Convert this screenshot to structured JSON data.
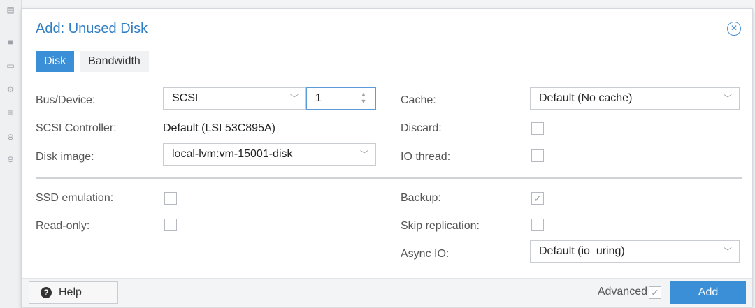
{
  "dialog": {
    "title": "Add: Unused Disk",
    "close_icon": "close-circle-icon"
  },
  "tabs": [
    {
      "label": "Disk",
      "active": true
    },
    {
      "label": "Bandwidth",
      "active": false
    }
  ],
  "left": {
    "bus_device_label": "Bus/Device:",
    "bus_value": "SCSI",
    "device_number": "1",
    "scsi_controller_label": "SCSI Controller:",
    "scsi_controller_value": "Default (LSI 53C895A)",
    "disk_image_label": "Disk image:",
    "disk_image_value": "local-lvm:vm-15001-disk"
  },
  "right": {
    "cache_label": "Cache:",
    "cache_value": "Default (No cache)",
    "discard_label": "Discard:",
    "discard_checked": false,
    "io_thread_label": "IO thread:",
    "io_thread_checked": false
  },
  "advanced_left": {
    "ssd_emulation_label": "SSD emulation:",
    "ssd_emulation_checked": false,
    "read_only_label": "Read-only:",
    "read_only_checked": false
  },
  "advanced_right": {
    "backup_label": "Backup:",
    "backup_checked": true,
    "skip_replication_label": "Skip replication:",
    "skip_replication_checked": false,
    "async_io_label": "Async IO:",
    "async_io_value": "Default (io_uring)"
  },
  "footer": {
    "help_label": "Help",
    "advanced_label": "Advanced",
    "advanced_checked": true,
    "add_label": "Add"
  },
  "colors": {
    "accent": "#3a8fd6",
    "title": "#2f7dc2"
  }
}
